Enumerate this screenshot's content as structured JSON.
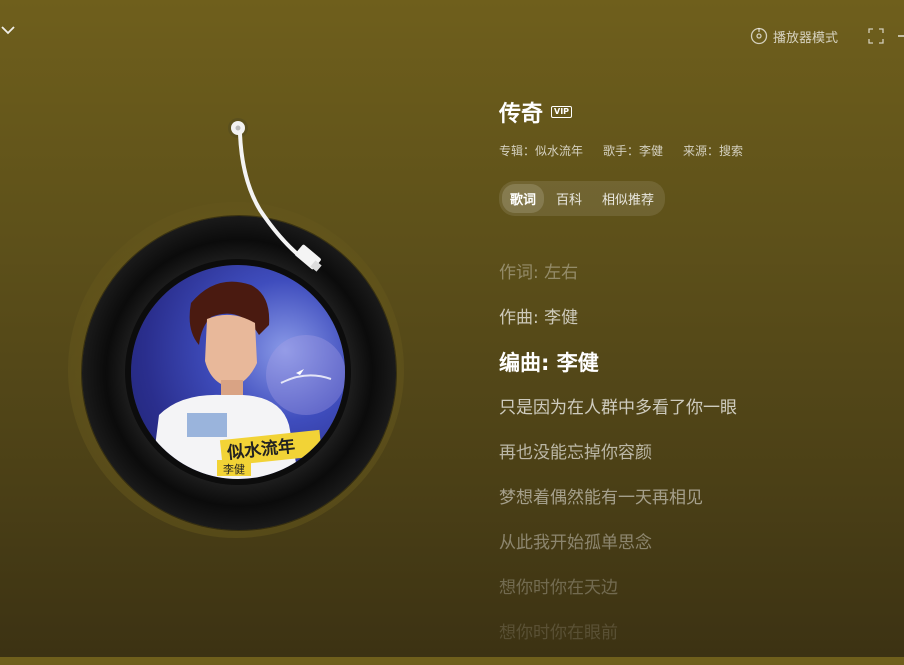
{
  "topbar": {
    "collapse_icon": "chevron-down-icon",
    "mode_icon": "disc-icon",
    "mode_label": "播放器模式",
    "fullscreen_icon": "fullscreen-icon"
  },
  "song": {
    "title": "传奇",
    "vip": "VIP",
    "album": "专辑：似水流年",
    "singer": "歌手：李健",
    "source": "来源：搜索"
  },
  "cover": {
    "title_text": "似水流年",
    "artist_text": "李健"
  },
  "tabs": [
    {
      "label": "歌词",
      "active": true
    },
    {
      "label": "百科",
      "active": false
    },
    {
      "label": "相似推荐",
      "active": false
    }
  ],
  "lyrics": [
    {
      "text": "作词: 左右",
      "opacity": 0.35
    },
    {
      "text": "作曲: 李健",
      "opacity": 0.7
    },
    {
      "text": "编曲: 李健",
      "opacity": 1.0,
      "active": true
    },
    {
      "text": "只是因为在人群中多看了你一眼",
      "opacity": 0.72
    },
    {
      "text": "再也没能忘掉你容颜",
      "opacity": 0.62
    },
    {
      "text": "梦想着偶然能有一天再相见",
      "opacity": 0.5
    },
    {
      "text": "从此我开始孤单思念",
      "opacity": 0.38
    },
    {
      "text": "想你时你在天边",
      "opacity": 0.26
    },
    {
      "text": "想你时你在眼前",
      "opacity": 0.14
    }
  ],
  "colors": {
    "background_top": "#6f5f1c",
    "background_bottom": "#3c3213"
  }
}
